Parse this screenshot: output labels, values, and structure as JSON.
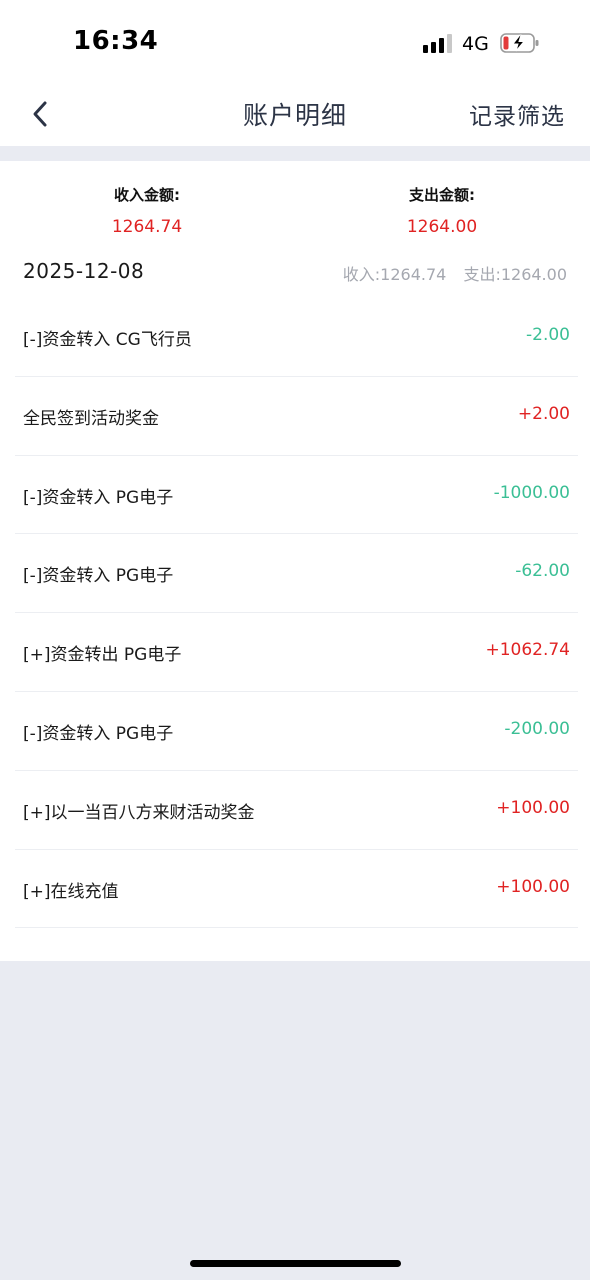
{
  "status_bar": {
    "time": "16:34",
    "network": "4G"
  },
  "nav": {
    "title": "账户明细",
    "filter_label": "记录筛选",
    "back_icon": "chevron-left-icon"
  },
  "summary": {
    "income_label": "收入金额:",
    "income_value": "1264.74",
    "expense_label": "支出金额:",
    "expense_value": "1264.00"
  },
  "day": {
    "date": "2025-12-08",
    "income_text": "收入:1264.74",
    "expense_text": "支出:1264.00"
  },
  "records": [
    {
      "title": "[-]资金转入 CG飞行员",
      "amount": "-2.00",
      "type": "neg"
    },
    {
      "title": "全民签到活动奖金",
      "amount": "+2.00",
      "type": "pos"
    },
    {
      "title": "[-]资金转入 PG电子",
      "amount": "-1000.00",
      "type": "neg"
    },
    {
      "title": "[-]资金转入 PG电子",
      "amount": "-62.00",
      "type": "neg"
    },
    {
      "title": "[+]资金转出 PG电子",
      "amount": "+1062.74",
      "type": "pos"
    },
    {
      "title": "[-]资金转入 PG电子",
      "amount": "-200.00",
      "type": "neg"
    },
    {
      "title": "[+]以一当百八方来财活动奖金",
      "amount": "+100.00",
      "type": "pos"
    },
    {
      "title": "[+]在线充值",
      "amount": "+100.00",
      "type": "pos"
    }
  ],
  "colors": {
    "income": "#e02323",
    "expense": "#3bbf95",
    "background": "#e9ebf2"
  }
}
